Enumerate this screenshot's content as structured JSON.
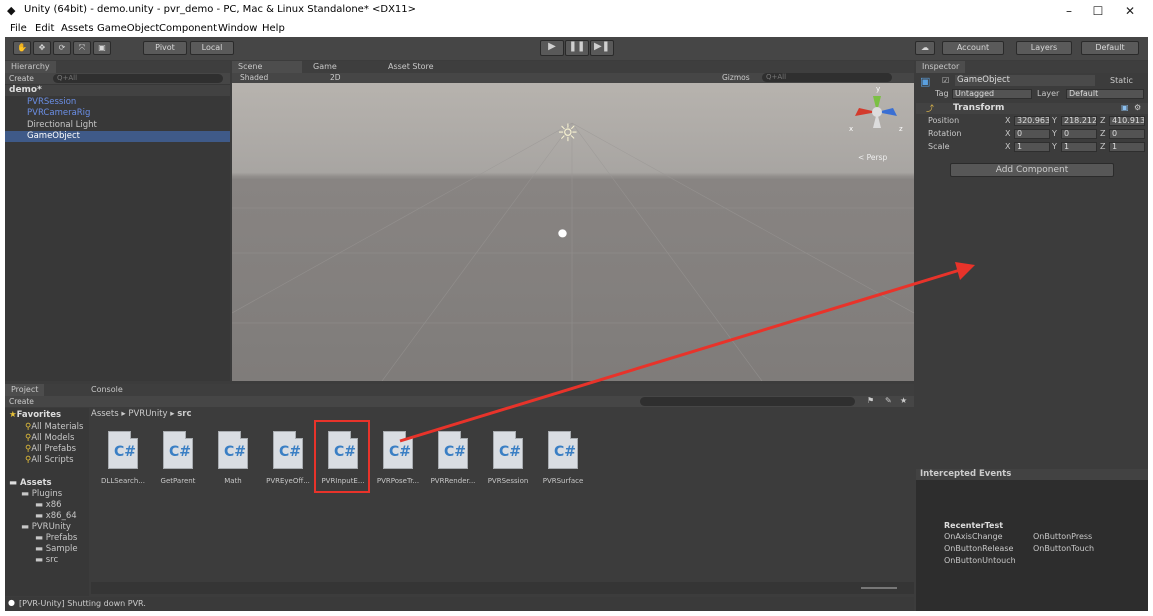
{
  "window": {
    "title": "Unity (64bit) - demo.unity - pvr_demo - PC, Mac & Linux Standalone* <DX11>",
    "minimize": "–",
    "maximize": "☐",
    "close": "✕"
  },
  "menu": [
    "File",
    "Edit",
    "Assets",
    "GameObject",
    "Component",
    "Window",
    "Help"
  ],
  "toolbar": {
    "pivot": "Pivot",
    "local": "Local",
    "account": "Account",
    "layers": "Layers",
    "layout": "Default"
  },
  "hierarchy": {
    "tab": "Hierarchy",
    "create": "Create",
    "search_placeholder": "Q+All",
    "scene": "demo*",
    "items": [
      "PVRSession",
      "PVRCameraRig",
      "Directional Light",
      "GameObject"
    ]
  },
  "scene": {
    "tabs": [
      "Scene",
      "Game",
      "Asset Store"
    ],
    "shading": "Shaded",
    "mode_2d": "2D",
    "gizmos": "Gizmos",
    "search_placeholder": "Q+All",
    "persp": "< Persp",
    "axes": {
      "x": "x",
      "y": "y",
      "z": "z"
    }
  },
  "inspector": {
    "tab": "Inspector",
    "object_name": "GameObject",
    "static": "Static",
    "tag_label": "Tag",
    "tag_value": "Untagged",
    "layer_label": "Layer",
    "layer_value": "Default",
    "component": "Transform",
    "rows": [
      {
        "label": "Position",
        "x": "320.963",
        "y": "218.212",
        "z": "410.913"
      },
      {
        "label": "Rotation",
        "x": "0",
        "y": "0",
        "z": "0"
      },
      {
        "label": "Scale",
        "x": "1",
        "y": "1",
        "z": "1"
      }
    ],
    "axis_labels": {
      "x": "X",
      "y": "Y",
      "z": "Z"
    },
    "add_component": "Add Component"
  },
  "events": {
    "title": "Intercepted Events",
    "object": "RecenterTest",
    "col1": [
      "OnAxisChange",
      "OnButtonRelease",
      "OnButtonUntouch"
    ],
    "col2": [
      "OnButtonPress",
      "OnButtonTouch"
    ]
  },
  "project": {
    "tabs": [
      "Project",
      "Console"
    ],
    "create": "Create",
    "favorites_title": "Favorites",
    "favorites": [
      "All Materials",
      "All Models",
      "All Prefabs",
      "All Scripts"
    ],
    "assets_title": "Assets",
    "tree": [
      "Plugins",
      "x86",
      "x86_64",
      "PVRUnity",
      "Prefabs",
      "Sample",
      "src"
    ],
    "breadcrumb": [
      "Assets",
      "PVRUnity",
      "src"
    ],
    "files": [
      "DLLSearch...",
      "GetParent",
      "Math",
      "PVREyeOff...",
      "PVRInputE...",
      "PVRPoseTr...",
      "PVRRender...",
      "PVRSession",
      "PVRSurface"
    ]
  },
  "status": {
    "text": "[PVR-Unity] Shutting down PVR."
  },
  "colors": {
    "annotation_red": "#e8332a",
    "hierarchy_blue": "#6b8fe6",
    "selection": "#3f5a88"
  }
}
